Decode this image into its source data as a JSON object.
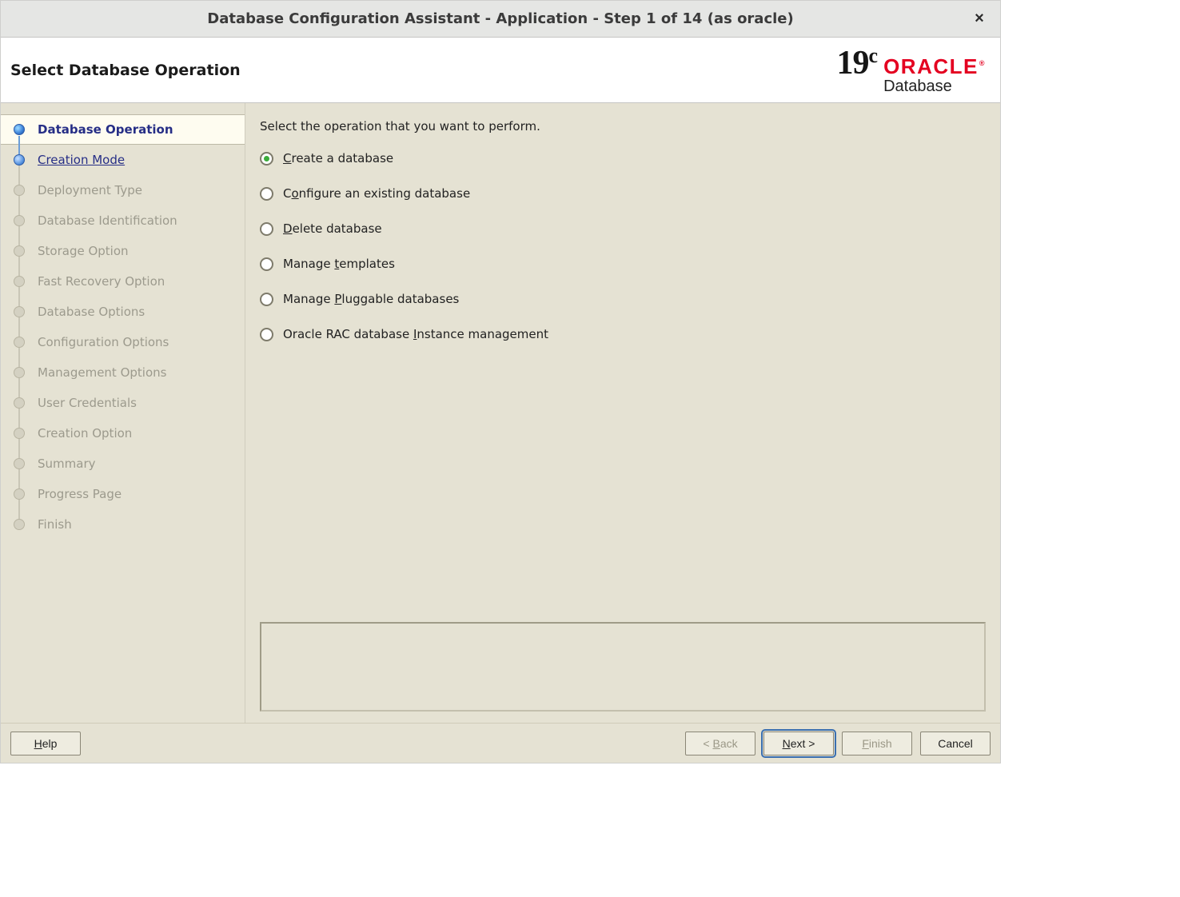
{
  "titlebar": {
    "title": "Database Configuration Assistant - Application - Step 1 of 14 (as oracle)",
    "close_label": "×"
  },
  "header": {
    "page_title": "Select Database Operation",
    "logo_version": "19",
    "logo_version_suffix": "c",
    "logo_brand": "ORACLE",
    "logo_sub": "Database"
  },
  "sidebar": {
    "steps": [
      {
        "label": "Database Operation",
        "state": "active"
      },
      {
        "label": "Creation Mode",
        "state": "next"
      },
      {
        "label": "Deployment Type",
        "state": "disabled"
      },
      {
        "label": "Database Identification",
        "state": "disabled"
      },
      {
        "label": "Storage Option",
        "state": "disabled"
      },
      {
        "label": "Fast Recovery Option",
        "state": "disabled"
      },
      {
        "label": "Database Options",
        "state": "disabled"
      },
      {
        "label": "Configuration Options",
        "state": "disabled"
      },
      {
        "label": "Management Options",
        "state": "disabled"
      },
      {
        "label": "User Credentials",
        "state": "disabled"
      },
      {
        "label": "Creation Option",
        "state": "disabled"
      },
      {
        "label": "Summary",
        "state": "disabled"
      },
      {
        "label": "Progress Page",
        "state": "disabled"
      },
      {
        "label": "Finish",
        "state": "disabled"
      }
    ]
  },
  "main": {
    "prompt": "Select the operation that you want to perform.",
    "options": [
      {
        "label": "Create a database",
        "mnemonic_index": 0,
        "selected": true
      },
      {
        "label": "Configure an existing database",
        "mnemonic_index": 1,
        "selected": false
      },
      {
        "label": "Delete database",
        "mnemonic_index": 0,
        "selected": false
      },
      {
        "label": "Manage templates",
        "mnemonic_index": 7,
        "selected": false
      },
      {
        "label": "Manage Pluggable databases",
        "mnemonic_index": 7,
        "selected": false
      },
      {
        "label": "Oracle RAC database Instance management",
        "mnemonic_index": 20,
        "selected": false
      }
    ]
  },
  "footer": {
    "help": {
      "label": "Help",
      "mnemonic_index": 0,
      "enabled": true,
      "primary": false
    },
    "back": {
      "label": "< Back",
      "mnemonic_index": 2,
      "enabled": false,
      "primary": false
    },
    "next": {
      "label": "Next >",
      "mnemonic_index": 0,
      "enabled": true,
      "primary": true
    },
    "finish": {
      "label": "Finish",
      "mnemonic_index": 0,
      "enabled": false,
      "primary": false
    },
    "cancel": {
      "label": "Cancel",
      "mnemonic_index": -1,
      "enabled": true,
      "primary": false
    }
  }
}
